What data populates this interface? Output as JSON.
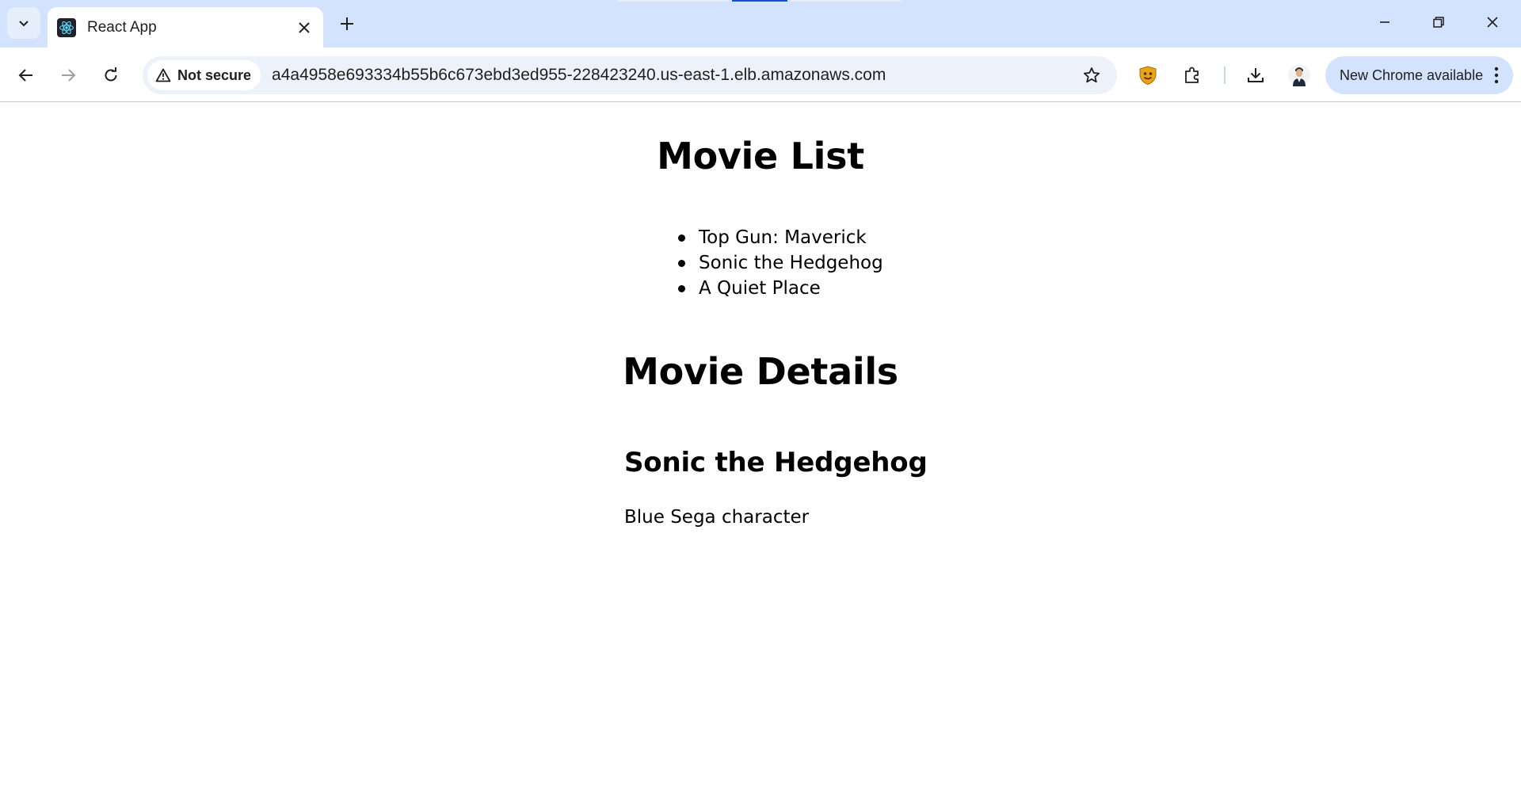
{
  "browser": {
    "tab": {
      "title": "React App",
      "favicon": "react-icon"
    },
    "address_bar": {
      "security_label": "Not secure",
      "url": "a4a4958e693334b55b6c673ebd3ed955-228423240.us-east-1.elb.amazonaws.com"
    },
    "update_button_label": "New Chrome available",
    "colors": {
      "tabstrip": "#d3e3fd",
      "omnibox": "#edf2fa",
      "update_chip": "#d3e3fd",
      "extension_shield": "#e8a317"
    }
  },
  "page": {
    "movie_list": {
      "heading": "Movie List",
      "items": [
        "Top Gun: Maverick",
        "Sonic the Hedgehog",
        "A Quiet Place"
      ]
    },
    "movie_details": {
      "heading": "Movie Details",
      "title": "Sonic the Hedgehog",
      "description": "Blue Sega character"
    }
  }
}
